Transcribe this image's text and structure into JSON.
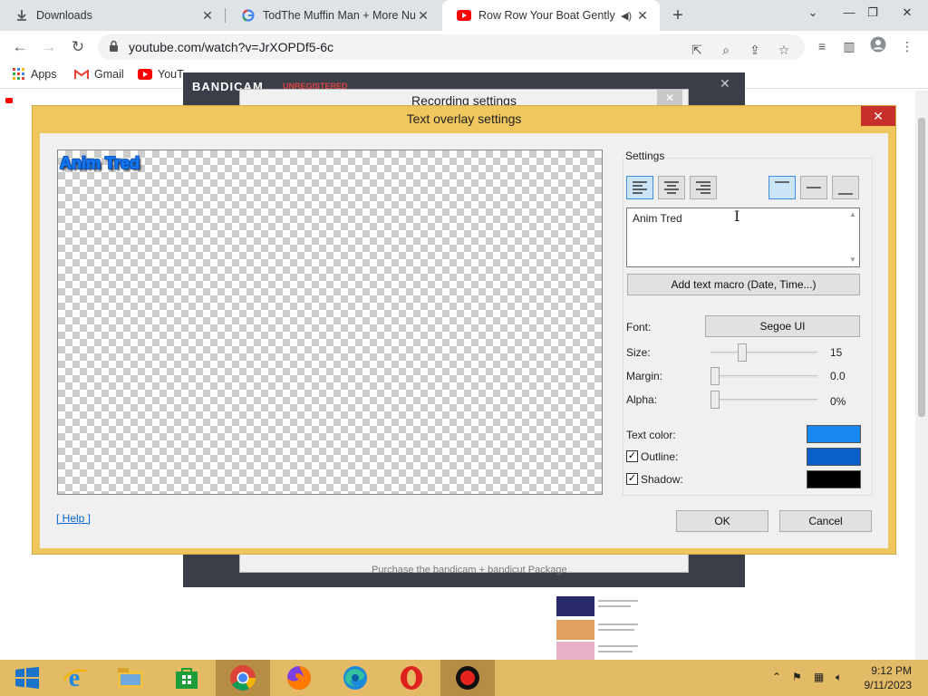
{
  "browser": {
    "tabs": [
      {
        "label": "Downloads",
        "favicon": "download-icon",
        "active": false
      },
      {
        "label": "TodThe Muffin Man + More Nurs",
        "favicon": "google-icon",
        "active": false
      },
      {
        "label": "Row Row Your Boat Gently D",
        "favicon": "youtube-icon",
        "active": true
      }
    ],
    "new_tab": "+",
    "url": "youtube.com/watch?v=JrXOPDf5-6c",
    "bookmarks": [
      {
        "label": "Apps",
        "icon": "apps-icon"
      },
      {
        "label": "Gmail",
        "icon": "gmail-icon"
      },
      {
        "label": "YouT",
        "icon": "youtube-icon"
      }
    ]
  },
  "background": {
    "bandicam_brand": "BANDICAM",
    "bandicam_status": "UNREGISTERED",
    "recording_title": "Recording settings",
    "purchase_text": "Purchase the bandicam + bandicut Package"
  },
  "dialog": {
    "title": "Text overlay settings",
    "preview_text": "Anim Tred",
    "settings_group": "Settings",
    "horizontal_align": [
      "left",
      "center",
      "right"
    ],
    "vertical_align": [
      "top",
      "middle",
      "bottom"
    ],
    "selected_horizontal": "left",
    "selected_vertical": "top",
    "overlay_text": "Anim Tred",
    "macro_button": "Add text macro (Date, Time...)",
    "font_label": "Font:",
    "font_value": "Segoe UI",
    "size_label": "Size:",
    "size_value": "15",
    "size_slider_fraction": 0.28,
    "margin_label": "Margin:",
    "margin_value": "0.0",
    "margin_slider_fraction": 0,
    "alpha_label": "Alpha:",
    "alpha_value": "0%",
    "alpha_slider_fraction": 0,
    "text_color_label": "Text color:",
    "text_color": "#1a86f0",
    "outline_label": "Outline:",
    "outline_checked": true,
    "outline_color": "#0a5fc8",
    "shadow_label": "Shadow:",
    "shadow_checked": true,
    "shadow_color": "#000000",
    "help_link": "[ Help ]",
    "ok_button": "OK",
    "cancel_button": "Cancel"
  },
  "taskbar": {
    "apps": [
      "windows-start-icon",
      "internet-explorer-icon",
      "file-explorer-icon",
      "microsoft-store-icon",
      "chrome-icon",
      "firefox-icon",
      "edge-icon",
      "opera-icon",
      "bandicam-record-icon"
    ],
    "active_app": "chrome-icon",
    "time": "9:12 PM",
    "date": "9/11/2023"
  }
}
